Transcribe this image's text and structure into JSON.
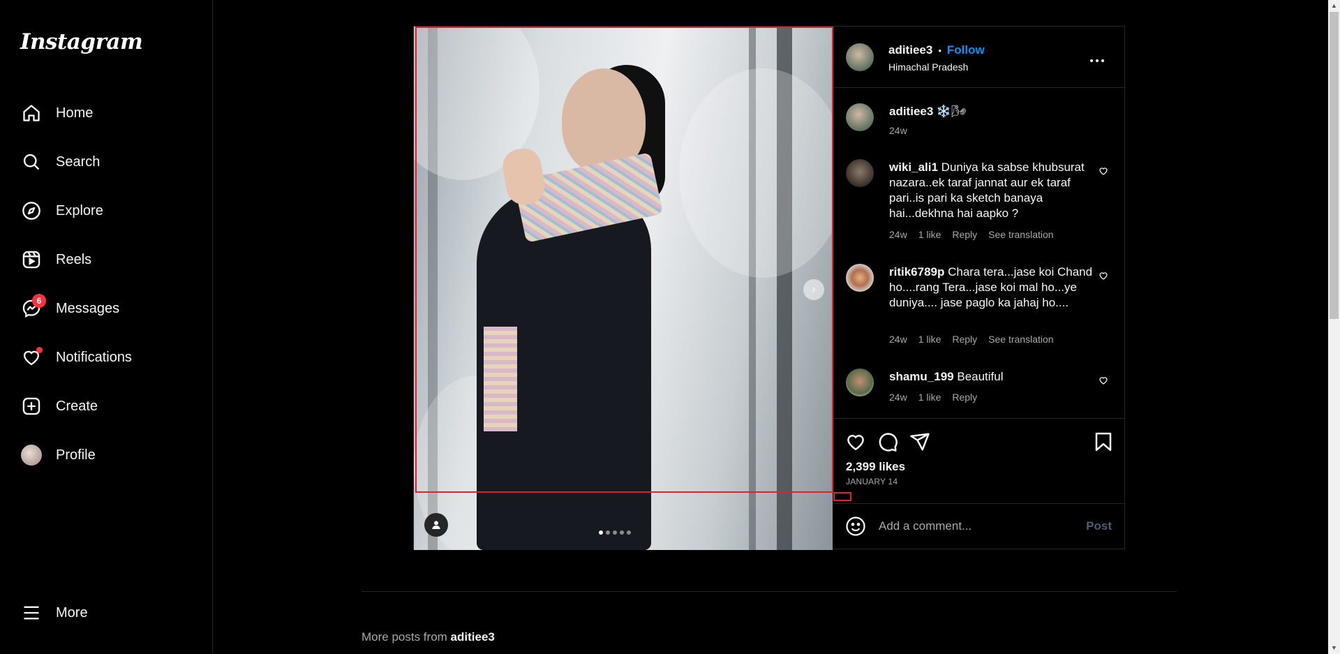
{
  "brand": {
    "logo_text": "Instagram"
  },
  "nav": {
    "home": "Home",
    "search": "Search",
    "explore": "Explore",
    "reels": "Reels",
    "messages": "Messages",
    "messages_badge": "6",
    "notifications": "Notifications",
    "create": "Create",
    "profile": "Profile",
    "more": "More"
  },
  "post": {
    "username": "aditiee3",
    "separator": "•",
    "follow_label": "Follow",
    "location": "Himachal Pradesh",
    "more_options": "...",
    "caption": {
      "username": "aditiee3",
      "text": "❄️🌬",
      "time": "24w"
    },
    "comments": [
      {
        "username": "wiki_ali1",
        "text": "Duniya ka sabse khubsurat nazara..ek taraf jannat aur ek taraf pari..is pari ka sketch banaya hai...dekhna hai aapko ?",
        "time": "24w",
        "likes": "1 like",
        "reply": "Reply",
        "translation": "See translation"
      },
      {
        "username": "ritik6789p",
        "text": "Chara tera...jase koi Chand ho....rang Tera...jase koi mal ho...ye duniya.... jase paglo ka jahaj ho....",
        "time": "24w",
        "likes": "1 like",
        "reply": "Reply",
        "translation": "See translation"
      },
      {
        "username": "shamu_199",
        "text": "Beautiful",
        "time": "24w",
        "likes": "1 like",
        "reply": "Reply"
      }
    ],
    "likes": "2,399 likes",
    "date": "JANUARY 14",
    "comment_placeholder": "Add a comment...",
    "post_button": "Post",
    "carousel": {
      "total": 5,
      "active": 0
    }
  },
  "more_posts": {
    "prefix": "More posts from",
    "username": "aditiee3"
  },
  "colors": {
    "accent": "#0095f6",
    "badge": "#ff3040",
    "highlight": "#e0202a"
  }
}
